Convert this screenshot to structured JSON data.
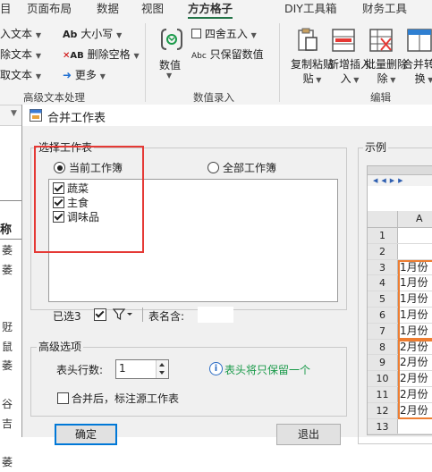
{
  "ribbon": {
    "tabs": [
      "目",
      "页面布局",
      "数据",
      "视图",
      "方方格子",
      "DIY工具箱",
      "财务工具"
    ],
    "active_tab": "方方格子",
    "text_group": {
      "insert_text": "入文本",
      "delete_text": "除文本",
      "extract_text": "取文本",
      "case": "大小写",
      "delete_space": "删除空格",
      "more": "更多",
      "label": "高级文本处理"
    },
    "number_group": {
      "value_btn": "数值",
      "round": "四舍五入",
      "keep_value": "只保留数值",
      "label": "数值录入"
    },
    "edit_group": {
      "copy_paste": "复制粘贴",
      "copy_paste_2": "贴",
      "insert": "新增插入",
      "insert_2": "入",
      "batch_delete": "批量删除",
      "batch_delete_2": "除",
      "merge": "合并转换",
      "merge_2": "换",
      "label": "编辑"
    }
  },
  "left_sheet": {
    "header": "称",
    "chars": [
      "萎",
      "萎",
      "",
      "",
      "觃",
      "鼠",
      "萎",
      "",
      "谷",
      "吉",
      "",
      "萎"
    ]
  },
  "dialog": {
    "title": "合并工作表",
    "select_legend": "选择工作表",
    "radio_current": "当前工作簿",
    "radio_all": "全部工作簿",
    "sheets": [
      "蔬菜",
      "主食",
      "调味品"
    ],
    "selected_text": "已选3",
    "sheet_name_label": "表名含:",
    "advanced_legend": "高级选项",
    "header_rows_label": "表头行数:",
    "header_rows_value": "1",
    "hint": "表头将只保留一个",
    "mark_source_label": "合并后，标注源工作表",
    "ok": "确定",
    "cancel": "退出",
    "example_label": "示例",
    "example": {
      "col_header": "A",
      "row_numbers": [
        "1",
        "2",
        "3",
        "4",
        "5",
        "6",
        "7",
        "8",
        "9",
        "10",
        "11",
        "12",
        "13"
      ],
      "values": [
        "",
        "",
        "1月份",
        "1月份",
        "1月份",
        "1月份",
        "1月份",
        "2月份",
        "2月份",
        "2月份",
        "2月份",
        "2月份",
        ""
      ]
    }
  },
  "colors": {
    "accent": "#217346",
    "highlight": "#e53935",
    "orange": "#ed7d31",
    "blue": "#1f6fd1"
  }
}
